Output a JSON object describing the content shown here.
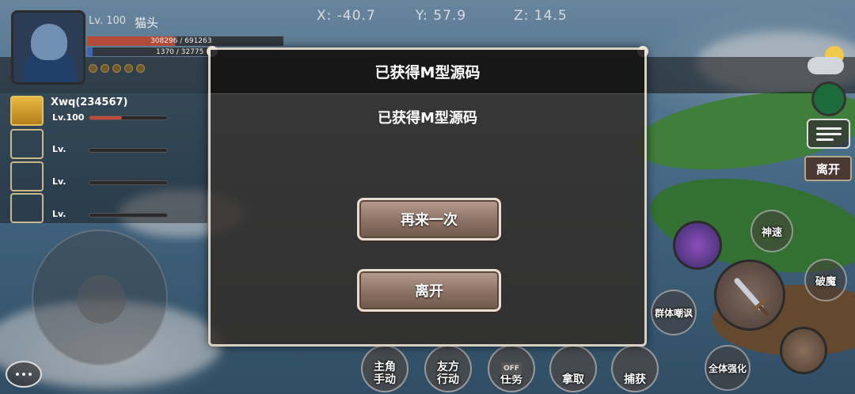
{
  "coords": {
    "x": "X: -40.7",
    "y": "Y: 57.9",
    "z": "Z: 14.5"
  },
  "player": {
    "level_label": "Lv. 100",
    "name": "猫头",
    "hp_text": "308296 / 691263",
    "hp_fraction": 0.446,
    "mp_text": "1370 / 32775",
    "mp_fraction": 0.042
  },
  "party": {
    "members": [
      {
        "name": "Xwq(234567)",
        "level": "Lv.100",
        "hp_fraction": 0.42
      },
      {
        "name": "",
        "level": "Lv.",
        "hp_fraction": 0
      },
      {
        "name": "",
        "level": "Lv.",
        "hp_fraction": 0
      },
      {
        "name": "",
        "level": "Lv.",
        "hp_fraction": 0
      }
    ]
  },
  "right_panel": {
    "leave_label": "离开"
  },
  "skills": {
    "speed": "神速",
    "break_magic": "破魔",
    "group_taunt": "群体嘲讽",
    "group_boost": "全体强化"
  },
  "bottom_bar": {
    "manual": "主角\n手动",
    "ally": "友方\n行动",
    "task": "任务",
    "task_tag": "OFF",
    "take": "拿取",
    "capture": "捕获"
  },
  "dialog": {
    "title": "已获得M型源码",
    "message": "已获得M型源码",
    "retry_label": "再来一次",
    "leave_label": "离开"
  },
  "colors": {
    "hp": "#b34b3b",
    "mp": "#3e66b5",
    "dialog_button": "#8c7265"
  }
}
